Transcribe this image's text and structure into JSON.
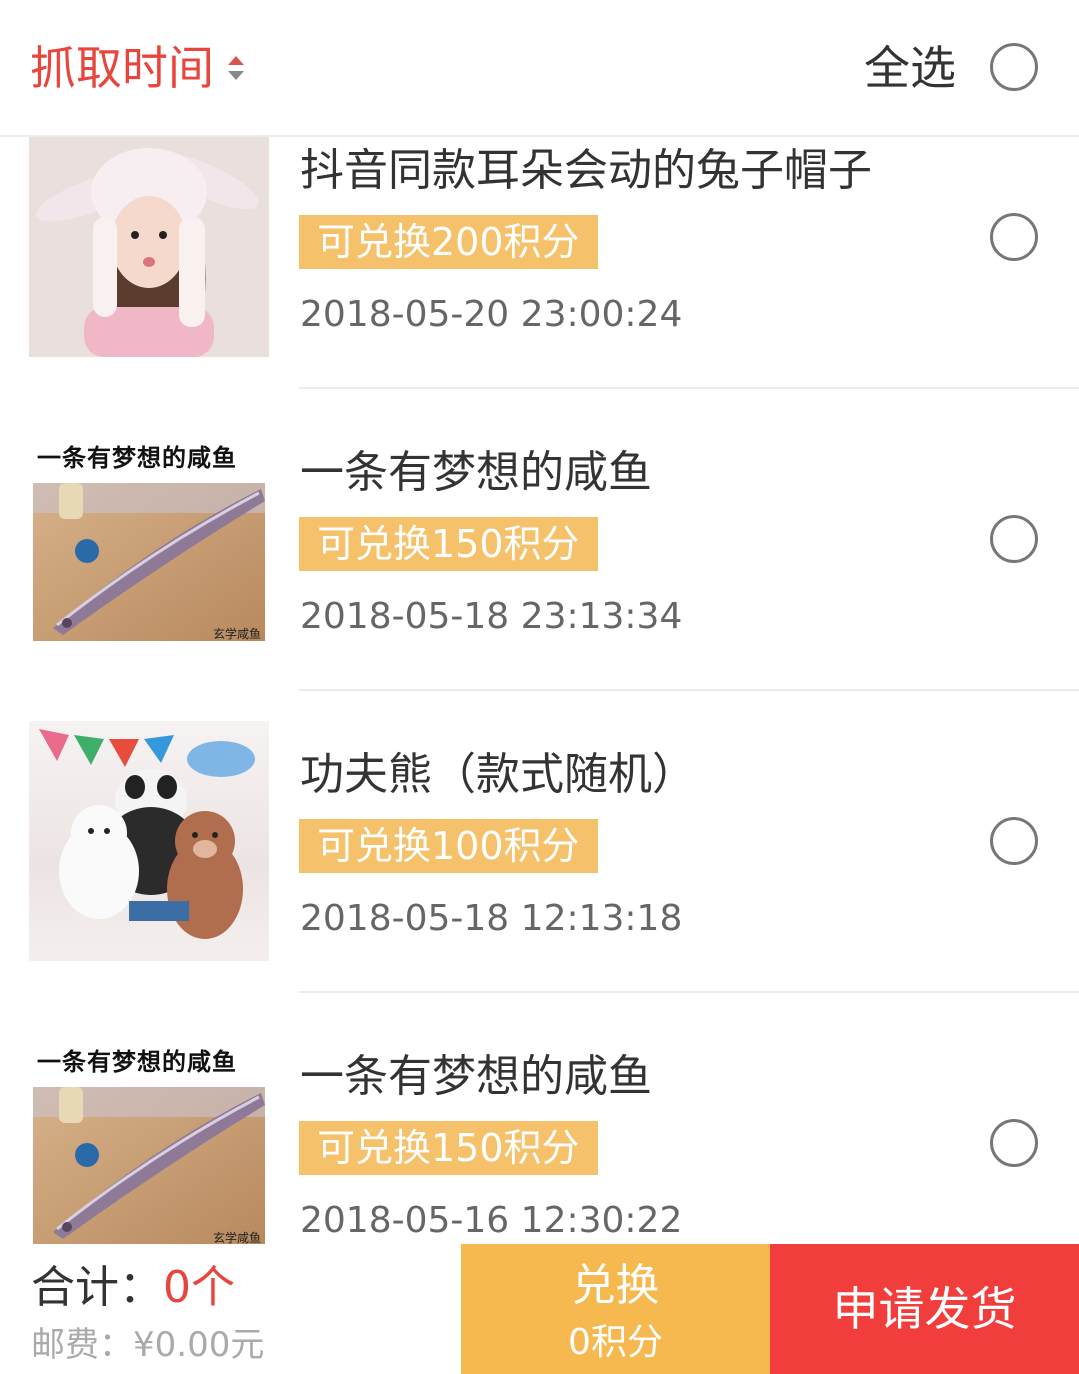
{
  "header": {
    "sort_label": "抓取时间",
    "select_all_label": "全选"
  },
  "items": [
    {
      "title": "抖音同款耳朵会动的兔子帽子",
      "points": "可兑换200积分",
      "time": "2018-05-20 23:00:24",
      "image": "bunny-hat-girl-photo"
    },
    {
      "title": "一条有梦想的咸鱼",
      "points": "可兑换150积分",
      "time": "2018-05-18 23:13:34",
      "image": "salted-fish-plush-photo",
      "image_caption": "一条有梦想的咸鱼",
      "image_watermark": "玄学咸鱼"
    },
    {
      "title": "功夫熊（款式随机）",
      "points": "可兑换100积分",
      "time": "2018-05-18 12:13:18",
      "image": "bears-plush-photo"
    },
    {
      "title": "一条有梦想的咸鱼",
      "points": "可兑换150积分",
      "time": "2018-05-16 12:30:22",
      "image": "salted-fish-plush-photo",
      "image_caption": "一条有梦想的咸鱼",
      "image_watermark": "玄学咸鱼"
    }
  ],
  "footer": {
    "total_label": "合计：",
    "total_count": "0个",
    "shipping": "邮费：¥0.00元",
    "exchange_label": "兑换",
    "exchange_points": "0积分",
    "ship_label": "申请发货"
  },
  "colors": {
    "accent_red": "#e8453c",
    "badge": "#f5c26b",
    "exchange_button": "#f5b94f",
    "ship_button": "#f23d3d"
  }
}
